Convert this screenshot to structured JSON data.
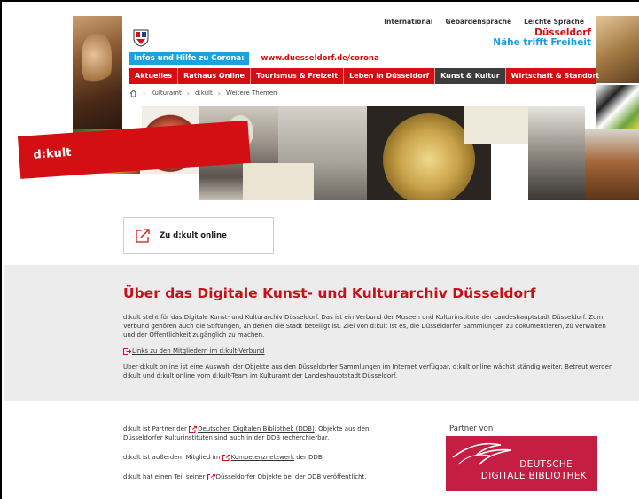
{
  "header": {
    "top_links": [
      "International",
      "Gebärdensprache",
      "Leichte Sprache"
    ],
    "logo_line1": "Düsseldorf",
    "logo_line2": "Nähe trifft Freiheit",
    "corona_badge": "Infos und Hilfe zu Corona:",
    "corona_link": "www.duesseldorf.de/corona",
    "nav_items": [
      "Aktuelles",
      "Rathaus Online",
      "Tourismus & Freizeit",
      "Leben in Düsseldorf",
      "Kunst & Kultur",
      "Wirtschaft & Standort"
    ],
    "active_nav": "Kunst & Kultur",
    "breadcrumb": [
      "Kulturamt",
      "d:kult",
      "Weitere Themen"
    ],
    "banner_label": "d:kult"
  },
  "online_button": {
    "label": "Zu d:kult online"
  },
  "about": {
    "title": "Über das Digitale Kunst- und Kulturarchiv Düsseldorf",
    "paragraph1": "d:kult steht für das Digitale Kunst- und Kulturarchiv Düsseldorf. Das ist ein Verbund der Museen und Kulturinstitute der Landeshauptstadt Düsseldorf. Zum Verbund gehören auch die Stiftungen, an denen die Stadt beteiligt ist. Ziel von d:kult ist es, die Düsseldorfer Sammlungen zu dokumentieren, zu verwalten und der Öffentlichkeit zugänglich zu machen.",
    "members_link": "Links zu den Mitgliedern im d:kult-Verbund",
    "paragraph2": "Über d:kult online ist eine Auswahl der Objekte aus den Düsseldorfer Sammlungen im Internet verfügbar. d:kult online wächst ständig weiter. Betreut werden d:kult und d:kult online vom d:kult-Team im Kulturamt der Landeshauptstadt Düsseldorf."
  },
  "partner": {
    "b1_pre": "d:kult ist Partner der ",
    "b1_link": "Deutschen Digitalen Bibliothek (DDB)",
    "b1_post": ". Objekte aus den Düsseldorfer Kulturinstituten sind auch in der DDB recherchierbar.",
    "b2_pre": "d:kult ist außerdem Mitglied im ",
    "b2_link": "Kompetenznetzwerk",
    "b2_post": " der DDB.",
    "b3_pre": "d:kult hat einen Teil seiner ",
    "b3_link": "Düsseldorfer Objekte",
    "b3_post": " bei der DDB veröffentlicht.",
    "partner_label": "Partner von",
    "ddb_line1": "DEUTSCHE",
    "ddb_line2": "DIGITALE BIBLIOTHEK"
  },
  "colors": {
    "accent_red": "#d40f14",
    "corona_blue": "#1ba1dc",
    "ddb_red": "#c61d43",
    "grey_section": "#ececec"
  }
}
